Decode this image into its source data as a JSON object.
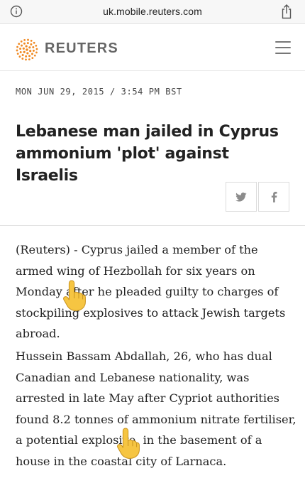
{
  "browser": {
    "url": "uk.mobile.reuters.com",
    "info_icon": "info-icon",
    "share_icon": "share-icon"
  },
  "header": {
    "brand": "REUTERS",
    "logo_icon": "reuters-logo-icon",
    "menu_icon": "hamburger-menu-icon"
  },
  "article": {
    "dateline": "MON JUN 29, 2015 / 3:54 PM BST",
    "headline": "Lebanese man jailed in Cyprus ammonium 'plot' against Israelis",
    "share_buttons": [
      "twitter-icon",
      "facebook-icon"
    ],
    "paragraphs": [
      "(Reuters) - Cyprus jailed a member of the armed wing of Hezbollah for six years on Monday after he pleaded guilty to charges of stockpiling explosives to attack Jewish targets abroad.",
      "Hussein Bassam Abdallah, 26, who has dual Canadian and Lebanese nationality, was arrested in late May after Cypriot authorities found 8.2 tonnes of ammonium nitrate fertiliser, a potential explosive, in the basement of a house in the coastal city of Larnaca."
    ]
  },
  "overlays": [
    "pointing-hand-icon",
    "pointing-hand-icon"
  ],
  "colors": {
    "brand_orange": "#f08a24",
    "text": "#222222",
    "muted": "#666666",
    "emoji_yellow": "#f6c542"
  }
}
